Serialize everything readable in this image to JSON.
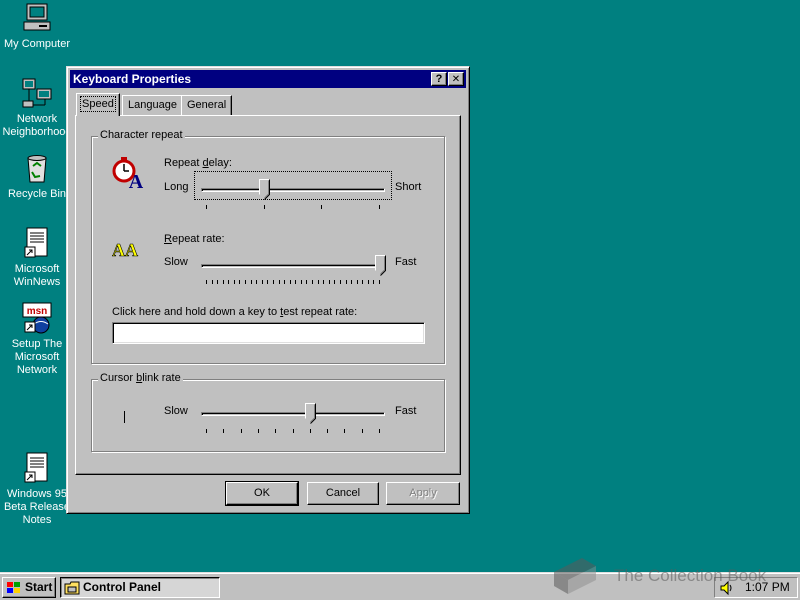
{
  "desktop": {
    "icons": [
      {
        "label": "My Computer",
        "icon": "my-computer-icon"
      },
      {
        "label": "Network\nNeighborhood",
        "icon": "network-neighborhood-icon"
      },
      {
        "label": "Recycle Bin",
        "icon": "recycle-bin-icon"
      },
      {
        "label": "Microsoft\nWinNews",
        "icon": "document-shortcut-icon"
      },
      {
        "label": "Setup The\nMicrosoft\nNetwork",
        "icon": "msn-setup-icon"
      },
      {
        "label": "Windows 95\nBeta Release\nNotes",
        "icon": "document-shortcut-icon"
      }
    ],
    "background_color": "#008080"
  },
  "window": {
    "title": "Keyboard Properties",
    "help_glyph": "?",
    "close_glyph": "✕",
    "tabs": [
      {
        "label": "Speed",
        "active": true
      },
      {
        "label": "Language",
        "active": false
      },
      {
        "label": "General",
        "active": false
      }
    ],
    "character_repeat": {
      "label": "Character repeat",
      "repeat_delay": {
        "label_underline": "d",
        "label_before": "Repeat ",
        "label_after": "elay:",
        "min_label": "Long",
        "max_label": "Short",
        "tick_count": 4,
        "position": 1,
        "icon": "stopwatch-a-icon"
      },
      "repeat_rate": {
        "label_underline": "R",
        "label_after": "epeat rate:",
        "min_label": "Slow",
        "max_label": "Fast",
        "tick_count": 32,
        "position": 31,
        "icon": "repeat-aa-icon"
      },
      "test_prompt_before": "Click here and hold down a key to ",
      "test_prompt_underline": "t",
      "test_prompt_after": "est repeat rate:",
      "test_value": ""
    },
    "cursor_blink": {
      "label_before": "Cursor ",
      "label_underline": "b",
      "label_after": "link rate",
      "min_label": "Slow",
      "max_label": "Fast",
      "tick_count": 11,
      "position": 6,
      "icon": "cursor-blink-icon"
    },
    "buttons": {
      "ok": "OK",
      "cancel": "Cancel",
      "apply": "Apply"
    }
  },
  "taskbar": {
    "start_label": "Start",
    "task_label": "Control Panel",
    "clock": "1:07 PM",
    "tray_icon": "speaker-icon"
  },
  "watermark": {
    "text": "The Collection Book"
  }
}
